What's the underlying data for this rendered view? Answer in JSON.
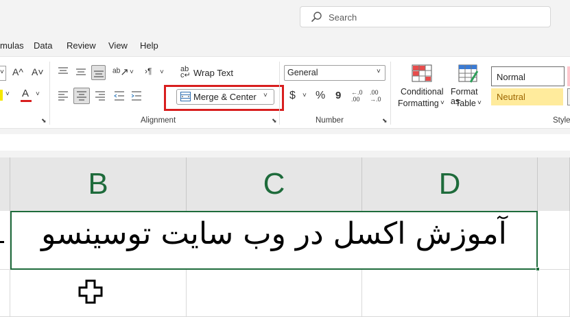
{
  "search": {
    "placeholder": "Search"
  },
  "menu": {
    "items": [
      "mulas",
      "Data",
      "Review",
      "View",
      "Help"
    ]
  },
  "ribbon": {
    "font_group": {
      "increase_font": "A^",
      "decrease_font": "A˅",
      "font_color_label": "A"
    },
    "alignment": {
      "wrap_text_label": "Wrap Text",
      "merge_center_label": "Merge & Center",
      "group_label": "Alignment"
    },
    "number": {
      "format_value": "General",
      "currency_symbol": "$",
      "percent_symbol": "%",
      "comma_symbol": "9",
      "increase_decimal": "←.0 .00",
      "decrease_decimal": ".00 →.0",
      "group_label": "Number"
    },
    "styles": {
      "conditional_formatting_line1": "Conditional",
      "conditional_formatting_line2": "Formatting",
      "format_as_table_line1": "Format as",
      "format_as_table_line2": "Table",
      "normal_label": "Normal",
      "neutral_label": "Neutral",
      "group_label": "Style"
    }
  },
  "columns": [
    "B",
    "C",
    "D"
  ],
  "merged_cell_text": "آموزش اکسل در وب سایت توسینسو",
  "colors": {
    "accent_green": "#1e6b3b",
    "highlight_red": "#d81e1e",
    "neutral_fill": "#ffeb9c",
    "neutral_text": "#9c6500"
  }
}
